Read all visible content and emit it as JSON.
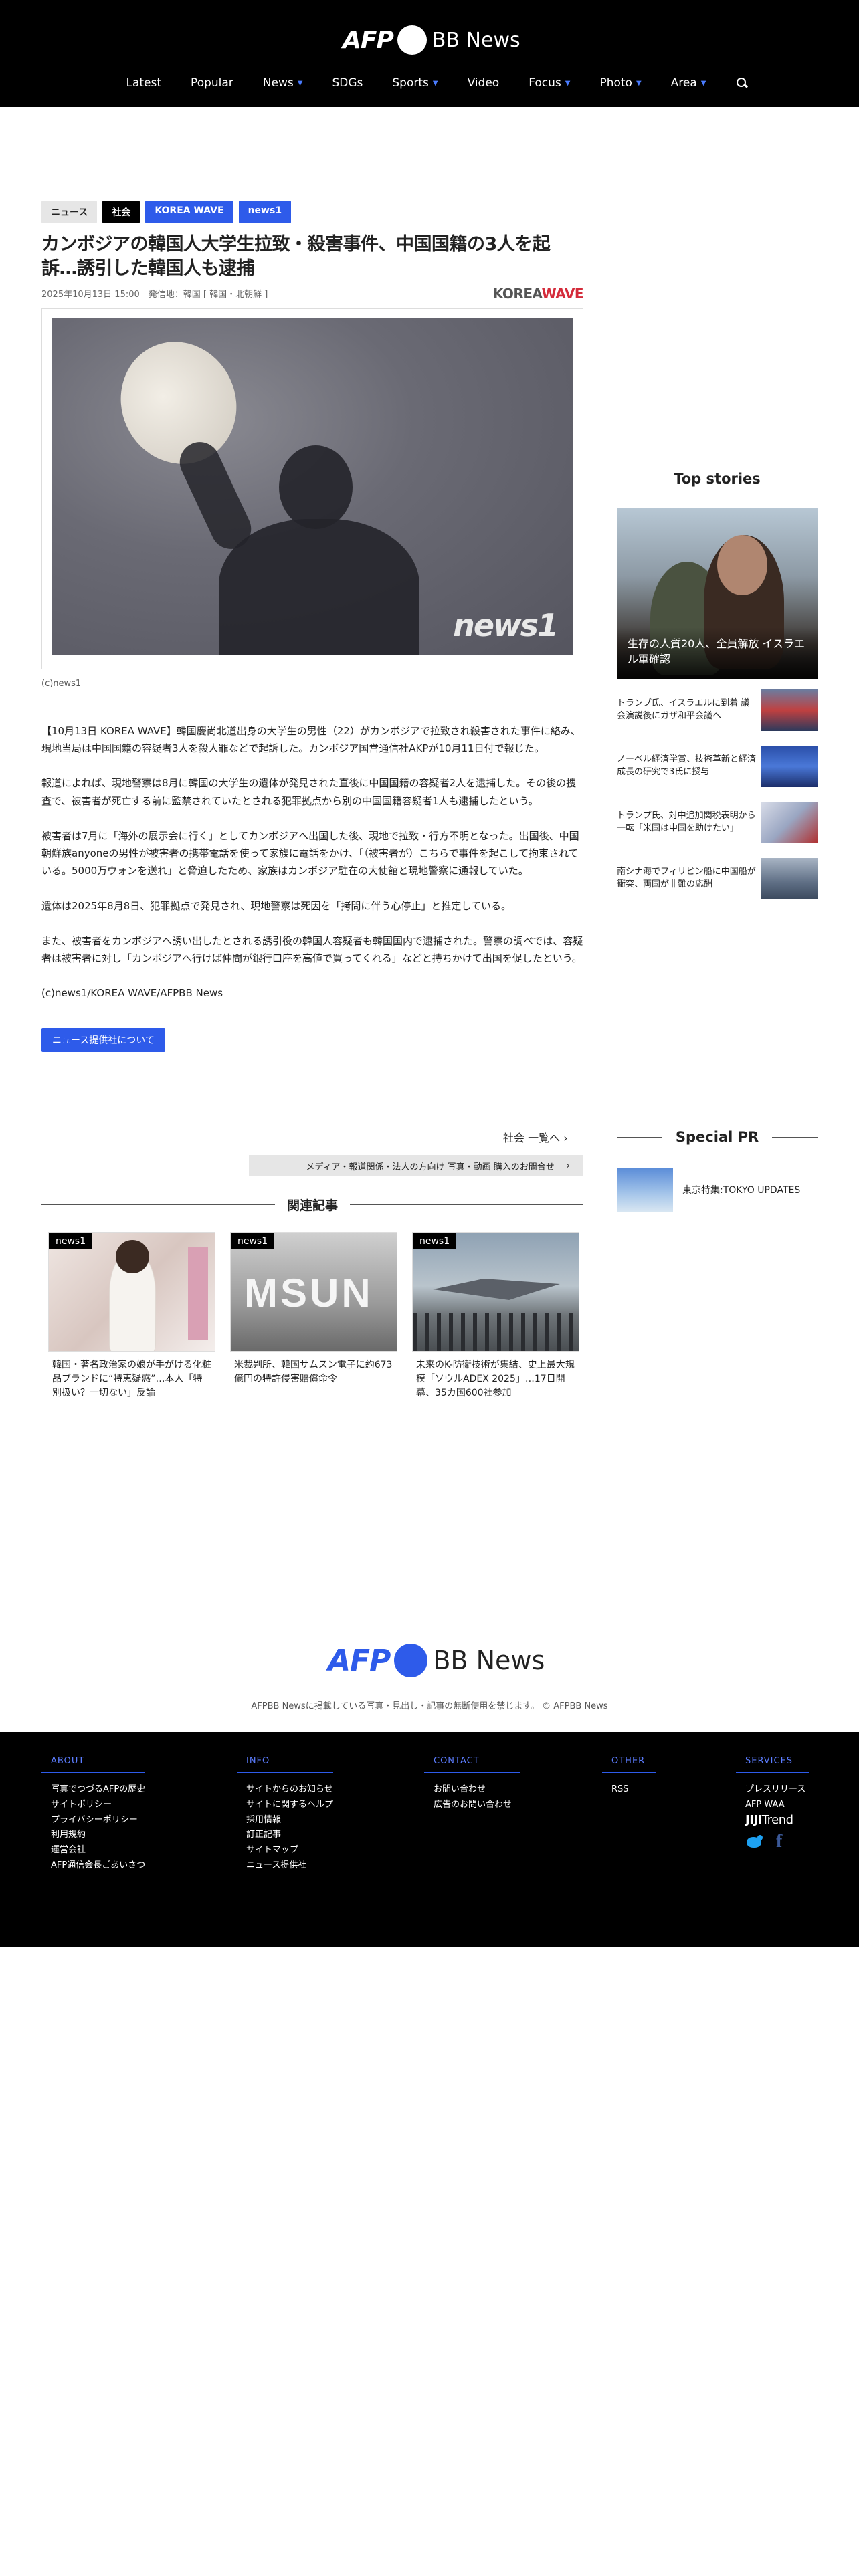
{
  "header": {
    "logo_afp": "AFP",
    "logo_bb": "BB News",
    "nav": [
      {
        "label": "Latest",
        "dropdown": false
      },
      {
        "label": "Popular",
        "dropdown": false
      },
      {
        "label": "News",
        "dropdown": true
      },
      {
        "label": "SDGs",
        "dropdown": false
      },
      {
        "label": "Sports",
        "dropdown": true
      },
      {
        "label": "Video",
        "dropdown": false
      },
      {
        "label": "Focus",
        "dropdown": true
      },
      {
        "label": "Photo",
        "dropdown": true
      },
      {
        "label": "Area",
        "dropdown": true
      }
    ],
    "search_icon": "search-icon"
  },
  "article": {
    "tags": [
      {
        "label": "ニュース",
        "style": "gray"
      },
      {
        "label": "社会",
        "style": "black"
      },
      {
        "label": "KOREA WAVE",
        "style": "blue"
      },
      {
        "label": "news1",
        "style": "blue"
      }
    ],
    "headline": "カンボジアの韓国人大学生拉致・殺害事件、中国国籍の3人を起訴…誘引した韓国人も逮捕",
    "meta": "2025年10月13日 15:00　発信地：韓国 [ 韓国・北朝鮮 ]",
    "source_logo_a": "KOREA",
    "source_logo_b": "WAVE",
    "photo_watermark": "news1",
    "caption": "(c)news1",
    "paragraphs": [
      "【10月13日 KOREA WAVE】韓国慶尚北道出身の大学生の男性（22）がカンボジアで拉致され殺害された事件に絡み、現地当局は中国国籍の容疑者3人を殺人罪などで起訴した。カンボジア国営通信社AKPが10月11日付で報じた。",
      "報道によれば、現地警察は8月に韓国の大学生の遺体が発見された直後に中国国籍の容疑者2人を逮捕した。その後の捜査で、被害者が死亡する前に監禁されていたとされる犯罪拠点から別の中国国籍容疑者1人も逮捕したという。",
      "被害者は7月に「海外の展示会に行く」としてカンボジアへ出国した後、現地で拉致・行方不明となった。出国後、中国朝鮮族anyoneの男性が被害者の携帯電話を使って家族に電話をかけ、「（被害者が）こちらで事件を起こして拘束されている。5000万ウォンを送れ」と脅迫したため、家族はカンボジア駐在の大使館と現地警察に通報していた。",
      "遺体は2025年8月8日、犯罪拠点で発見され、現地警察は死因を「拷問に伴う心停止」と推定している。",
      "また、被害者をカンボジアへ誘い出したとされる誘引役の韓国人容疑者も韓国国内で逮捕された。警察の調べでは、容疑者は被害者に対し「カンボジアへ行けば仲間が銀行口座を高値で買ってくれる」などと持ちかけて出国を促したという。",
      "(c)news1/KOREA WAVE/AFPBB News"
    ],
    "provider_button": "ニュース提供社について",
    "more_link": "社会 一覧へ",
    "media_bar": "メディア・報道関係・法人の方向け 写真・動画 購入のお問合せ",
    "related_heading": "関連記事",
    "related": [
      {
        "badge": "news1",
        "text": "韓国・著名政治家の娘が手がける化粧品ブランドに“特恵疑惑”…本人「特別扱い？一切ない」反論"
      },
      {
        "badge": "news1",
        "text": "米裁判所、韓国サムスン電子に約673億円の特許侵害賠償命令"
      },
      {
        "badge": "news1",
        "text": "未来のK-防衛技術が集結、史上最大規模「ソウルADEX 2025」…17日開幕、35カ国600社参加"
      }
    ]
  },
  "sidebar": {
    "top_heading": "Top stories",
    "feature_title": "生存の人質20人、全員解放 イスラエル軍確認",
    "stories": [
      {
        "text": "トランプ氏、イスラエルに到着 議会演説後にガザ和平会議へ"
      },
      {
        "text": "ノーベル経済学賞、技術革新と経済成長の研究で3氏に授与"
      },
      {
        "text": "トランプ氏、対中追加関税表明から一転「米国は中国を助けたい」"
      },
      {
        "text": "南シナ海でフィリピン船に中国船が衝突、両国が非難の応酬"
      }
    ],
    "pr_heading": "Special PR",
    "pr_item": "東京特集:TOKYO UPDATES"
  },
  "footer": {
    "logo_afp": "AFP",
    "logo_bb": "BB News",
    "copyright": "AFPBB Newsに掲載している写真・見出し・記事の無断使用を禁じます。 © AFPBB News",
    "columns": [
      {
        "title": "ABOUT",
        "links": [
          "写真でつづるAFPの歴史",
          "サイトポリシー",
          "プライバシーポリシー",
          "利用規約",
          "運営会社",
          "AFP通信会長ごあいさつ"
        ]
      },
      {
        "title": "INFO",
        "links": [
          "サイトからのお知らせ",
          "サイトに関するヘルプ",
          "採用情報",
          "訂正記事",
          "サイトマップ",
          "ニュース提供社"
        ]
      },
      {
        "title": "CONTACT",
        "links": [
          "お問い合わせ",
          "広告のお問い合わせ"
        ]
      },
      {
        "title": "OTHER",
        "links": [
          "RSS"
        ]
      },
      {
        "title": "SERVICES",
        "links": [
          "プレスリリース",
          "AFP WAA"
        ]
      }
    ],
    "jiji_a": "JIJI",
    "jiji_b": "Trend"
  },
  "colors": {
    "accent": "#2e5bea",
    "header_bg": "#000000",
    "kwave_red": "#d42b3a"
  }
}
